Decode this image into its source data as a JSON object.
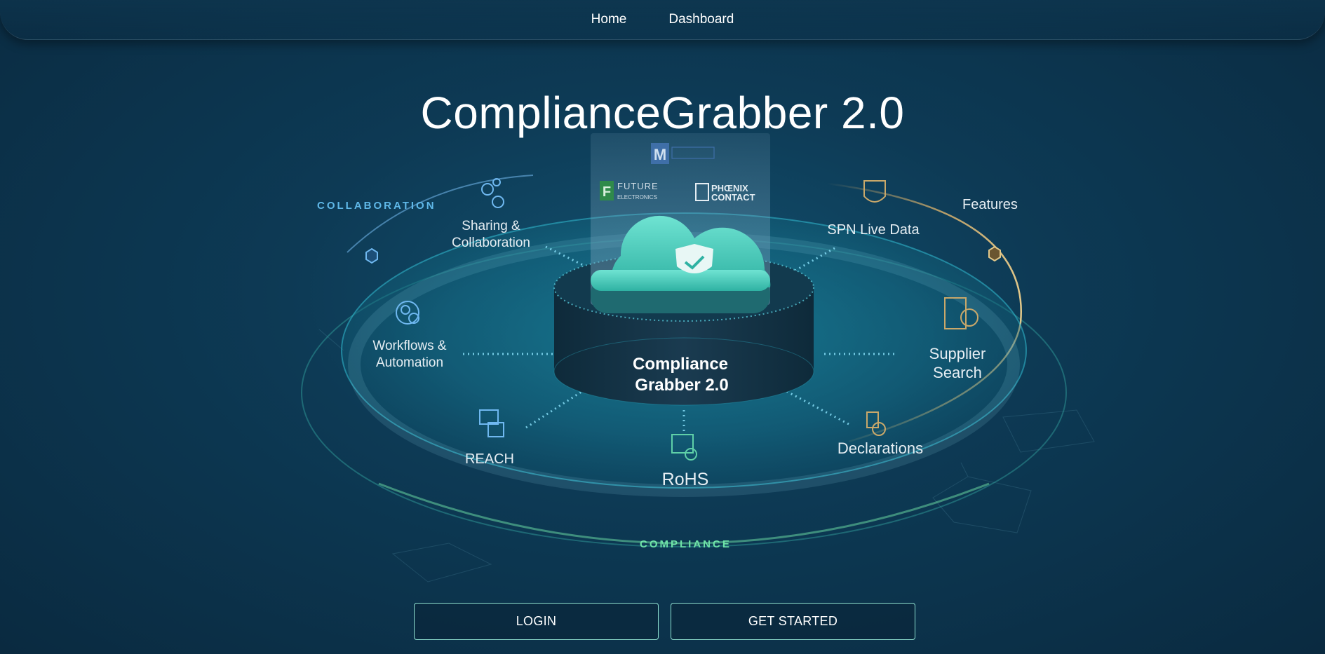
{
  "nav": {
    "links": [
      {
        "label": "Home"
      },
      {
        "label": "Dashboard"
      }
    ]
  },
  "hero": {
    "title": "ComplianceGrabber 2.0"
  },
  "illustration": {
    "center_label_line1": "Compliance",
    "center_label_line2": "Grabber 2.0",
    "ring_label_left": "COLLABORATION",
    "ring_label_bottom": "COMPLIANCE",
    "ring_label_right": "Features",
    "logos": {
      "top": "M",
      "left_mark": "F",
      "left_line1": "FUTURE",
      "left_line2": "ELECTRONICS",
      "right_line1": "PHŒNIX",
      "right_line2": "CONTACT"
    },
    "features": {
      "sharing_line1": "Sharing &",
      "sharing_line2": "Collaboration",
      "workflows_line1": "Workflows &",
      "workflows_line2": "Automation",
      "reach": "REACH",
      "rohs": "RoHS",
      "spn": "SPN Live Data",
      "supplier_line1": "Supplier",
      "supplier_line2": "Search",
      "declarations": "Declarations"
    }
  },
  "actions": {
    "login_label": "LOGIN",
    "get_started_label": "GET STARTED"
  },
  "colors": {
    "accent": "#8fe0d0",
    "teal": "#3fc7b8",
    "gold": "#c9a86a"
  }
}
